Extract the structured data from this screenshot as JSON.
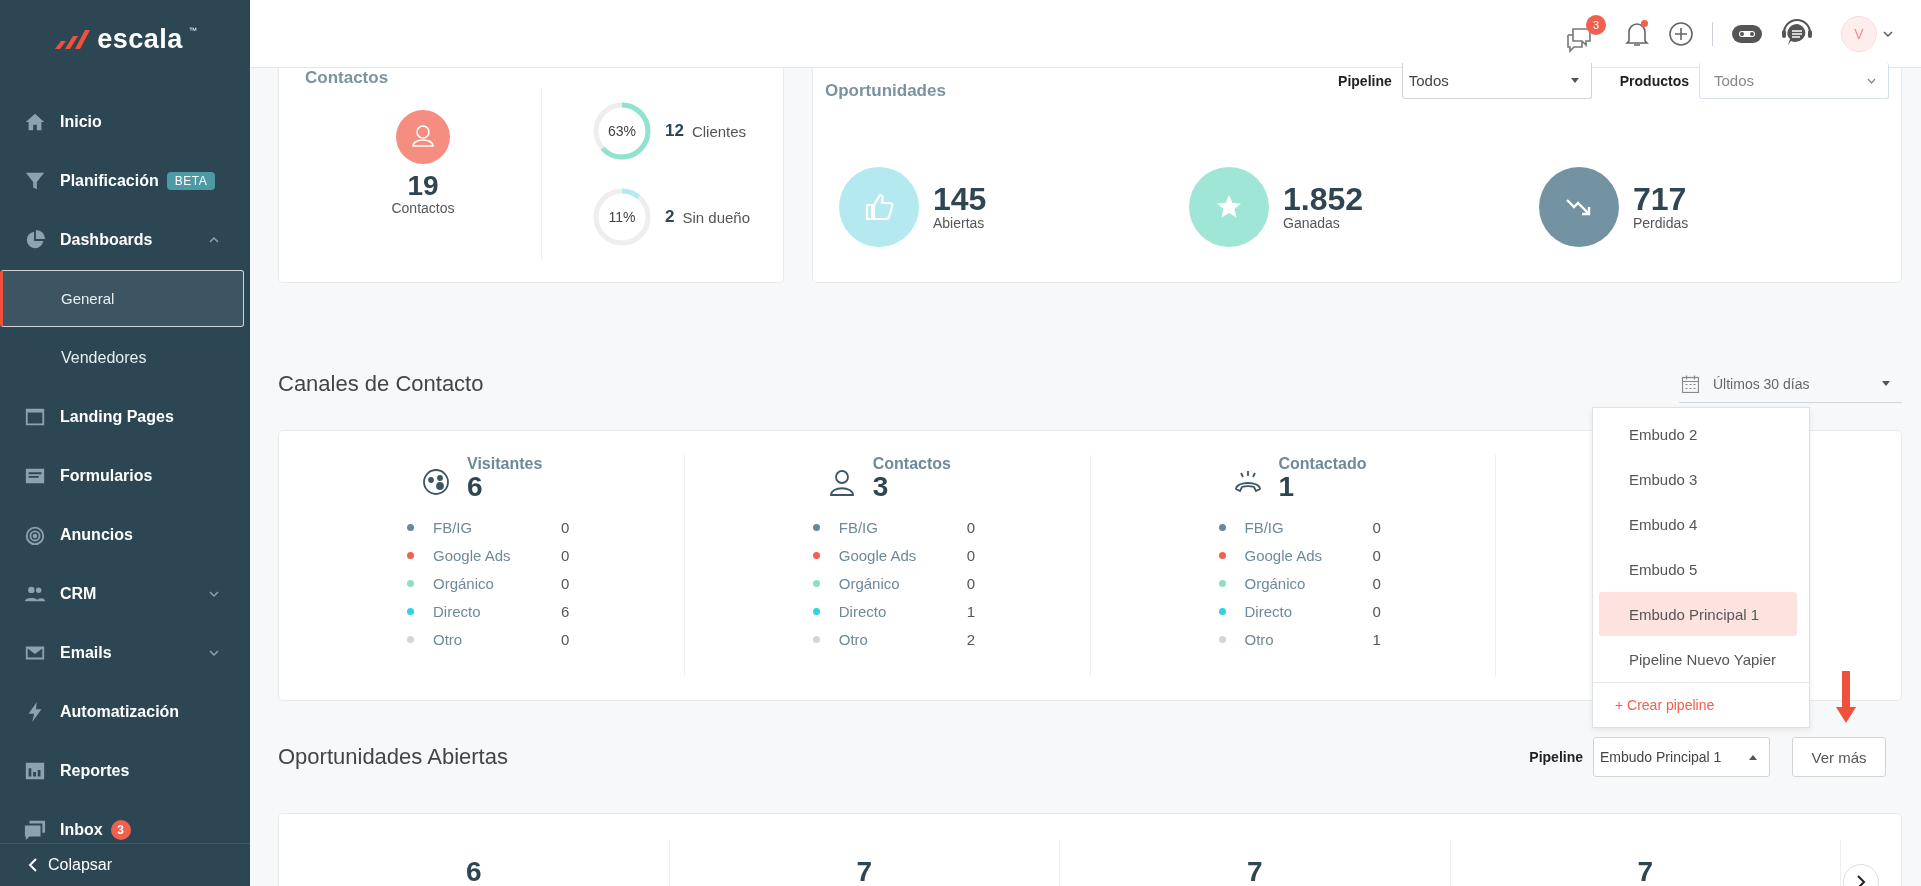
{
  "sidebar": {
    "brand": "escala",
    "brand_mark": "™",
    "items": [
      {
        "kind": "item",
        "label": "Inicio",
        "selected": false
      },
      {
        "kind": "item",
        "label": "Planificación",
        "badge": "BETA",
        "selected": false
      },
      {
        "kind": "item",
        "label": "Dashboards",
        "expanded": true,
        "selected": false
      },
      {
        "kind": "subitem",
        "label": "General",
        "selected": true
      },
      {
        "kind": "subitem",
        "label": "Vendedores",
        "selected": false
      },
      {
        "kind": "item",
        "label": "Landing Pages",
        "selected": false
      },
      {
        "kind": "item",
        "label": "Formularios",
        "selected": false
      },
      {
        "kind": "item",
        "label": "Anuncios",
        "selected": false
      },
      {
        "kind": "item",
        "label": "CRM",
        "expanded": false,
        "selected": false
      },
      {
        "kind": "item",
        "label": "Emails",
        "expanded": false,
        "selected": false
      },
      {
        "kind": "item",
        "label": "Automatización",
        "selected": false
      },
      {
        "kind": "item",
        "label": "Reportes",
        "selected": false
      },
      {
        "kind": "item",
        "label": "Inbox",
        "count": "3",
        "selected": false
      }
    ],
    "collapse": "Colapsar"
  },
  "header": {
    "chat_count": "3",
    "bell_dot": true,
    "avatar": "V"
  },
  "contacts_card": {
    "title": "Contactos",
    "total": "19",
    "total_label": "Contactos",
    "rings": [
      {
        "percent": "63%",
        "level": 0.63,
        "count": "12",
        "label": "Clientes",
        "color": "#8fe3cf"
      },
      {
        "percent": "11%",
        "level": 0.11,
        "count": "2",
        "label": "Sin dueño",
        "color": "#b4e9f0"
      }
    ]
  },
  "opportunities_card": {
    "title": "Oportunidades",
    "filters": [
      {
        "kind": "solid",
        "label": "Pipeline",
        "value": "Todos"
      },
      {
        "kind": "chevron",
        "label": "Productos",
        "placeholder": "Todos"
      }
    ],
    "stats": [
      {
        "value": "145",
        "label": "Abiertas",
        "color": "#b4e9f0"
      },
      {
        "value": "1.852",
        "label": "Ganadas",
        "color": "#9fe6d6"
      },
      {
        "value": "717",
        "label": "Perdidas",
        "color": "#7393a3"
      }
    ]
  },
  "channels": {
    "title": "Canales de Contacto",
    "date_range": "Últimos 30 días",
    "columns": [
      {
        "title": "Visitantes",
        "value": "6",
        "rows": [
          {
            "label": "FB/IG",
            "value": "0",
            "color": "#6b8797"
          },
          {
            "label": "Google Ads",
            "value": "0",
            "color": "#f0604d"
          },
          {
            "label": "Orgánico",
            "value": "0",
            "color": "#8fdcc7"
          },
          {
            "label": "Directo",
            "value": "6",
            "color": "#2fd3e4"
          },
          {
            "label": "Otro",
            "value": "0",
            "color": "#d5d5d5"
          }
        ]
      },
      {
        "title": "Contactos",
        "value": "3",
        "rows": [
          {
            "label": "FB/IG",
            "value": "0",
            "color": "#6b8797"
          },
          {
            "label": "Google Ads",
            "value": "0",
            "color": "#f0604d"
          },
          {
            "label": "Orgánico",
            "value": "0",
            "color": "#8fdcc7"
          },
          {
            "label": "Directo",
            "value": "1",
            "color": "#2fd3e4"
          },
          {
            "label": "Otro",
            "value": "2",
            "color": "#d5d5d5"
          }
        ]
      },
      {
        "title": "Contactado",
        "value": "1",
        "rows": [
          {
            "label": "FB/IG",
            "value": "0",
            "color": "#6b8797"
          },
          {
            "label": "Google Ads",
            "value": "0",
            "color": "#f0604d"
          },
          {
            "label": "Orgánico",
            "value": "0",
            "color": "#8fdcc7"
          },
          {
            "label": "Directo",
            "value": "0",
            "color": "#2fd3e4"
          },
          {
            "label": "Otro",
            "value": "1",
            "color": "#d5d5d5"
          }
        ]
      }
    ]
  },
  "pipeline_menu": {
    "items": [
      {
        "label": "Embudo 2",
        "selected": false
      },
      {
        "label": "Embudo 3",
        "selected": false
      },
      {
        "label": "Embudo 4",
        "selected": false
      },
      {
        "label": "Embudo 5",
        "selected": false
      },
      {
        "label": "Embudo Principal 1",
        "selected": true
      },
      {
        "label": "Pipeline Nuevo Yapier",
        "selected": false
      }
    ],
    "create": "+ Crear pipeline"
  },
  "open_opportunities": {
    "title": "Oportunidades Abiertas",
    "pipeline_label": "Pipeline",
    "pipeline_value": "Embudo Principal 1",
    "more": "Ver más",
    "values": [
      "6",
      "7",
      "7",
      "7"
    ]
  }
}
